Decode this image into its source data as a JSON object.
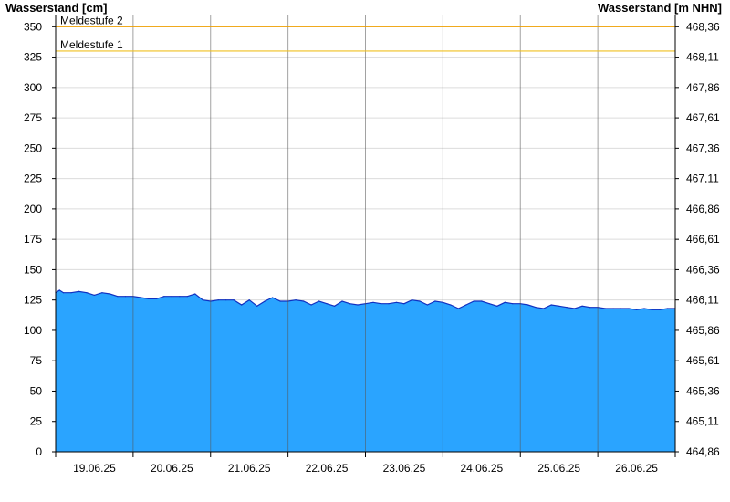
{
  "chart_data": {
    "type": "area",
    "ylabel_left": "Wasserstand [cm]",
    "ylabel_right": "Wasserstand [m NHN]",
    "ylim": [
      0,
      360
    ],
    "yticks_left": [
      0,
      25,
      50,
      75,
      100,
      125,
      150,
      175,
      200,
      225,
      250,
      275,
      300,
      325,
      350
    ],
    "yticks_right": [
      "464,86",
      "465,11",
      "465,36",
      "465,61",
      "465,86",
      "466,11",
      "466,36",
      "466,61",
      "466,86",
      "467,11",
      "467,36",
      "467,61",
      "467,86",
      "468,11",
      "468,36"
    ],
    "xticks": [
      "19.06.25",
      "20.06.25",
      "21.06.25",
      "22.06.25",
      "23.06.25",
      "24.06.25",
      "25.06.25",
      "26.06.25"
    ],
    "x_range_days": [
      0,
      8
    ],
    "grid": true,
    "thresholds": [
      {
        "label": "Meldestufe 2",
        "value": 350,
        "color": "#f0a000"
      },
      {
        "label": "Meldestufe 1",
        "value": 330,
        "color": "#f0c020"
      }
    ],
    "series": [
      {
        "color": "#2aa4ff",
        "x": [
          0.0,
          0.05,
          0.1,
          0.2,
          0.3,
          0.4,
          0.5,
          0.6,
          0.7,
          0.8,
          0.9,
          1.0,
          1.1,
          1.2,
          1.3,
          1.4,
          1.5,
          1.6,
          1.7,
          1.8,
          1.9,
          2.0,
          2.1,
          2.2,
          2.3,
          2.4,
          2.5,
          2.6,
          2.7,
          2.8,
          2.9,
          3.0,
          3.1,
          3.2,
          3.3,
          3.4,
          3.5,
          3.6,
          3.7,
          3.8,
          3.9,
          4.0,
          4.1,
          4.2,
          4.3,
          4.4,
          4.5,
          4.6,
          4.7,
          4.8,
          4.9,
          5.0,
          5.1,
          5.2,
          5.3,
          5.4,
          5.5,
          5.6,
          5.7,
          5.8,
          5.9,
          6.0,
          6.1,
          6.2,
          6.3,
          6.4,
          6.5,
          6.6,
          6.7,
          6.8,
          6.9,
          7.0,
          7.1,
          7.2,
          7.3,
          7.4,
          7.5,
          7.6,
          7.7,
          7.8,
          7.9,
          8.0
        ],
        "values": [
          131,
          133,
          131,
          131,
          132,
          131,
          129,
          131,
          130,
          128,
          128,
          128,
          127,
          126,
          126,
          128,
          128,
          128,
          128,
          130,
          125,
          124,
          125,
          125,
          125,
          121,
          125,
          120,
          124,
          127,
          124,
          124,
          125,
          124,
          121,
          124,
          122,
          120,
          124,
          122,
          121,
          122,
          123,
          122,
          122,
          123,
          122,
          125,
          124,
          121,
          124,
          123,
          121,
          118,
          121,
          124,
          124,
          122,
          120,
          123,
          122,
          122,
          121,
          119,
          118,
          121,
          120,
          119,
          118,
          120,
          119,
          119,
          118,
          118,
          118,
          118,
          117,
          118,
          117,
          117,
          118,
          118
        ]
      }
    ]
  }
}
